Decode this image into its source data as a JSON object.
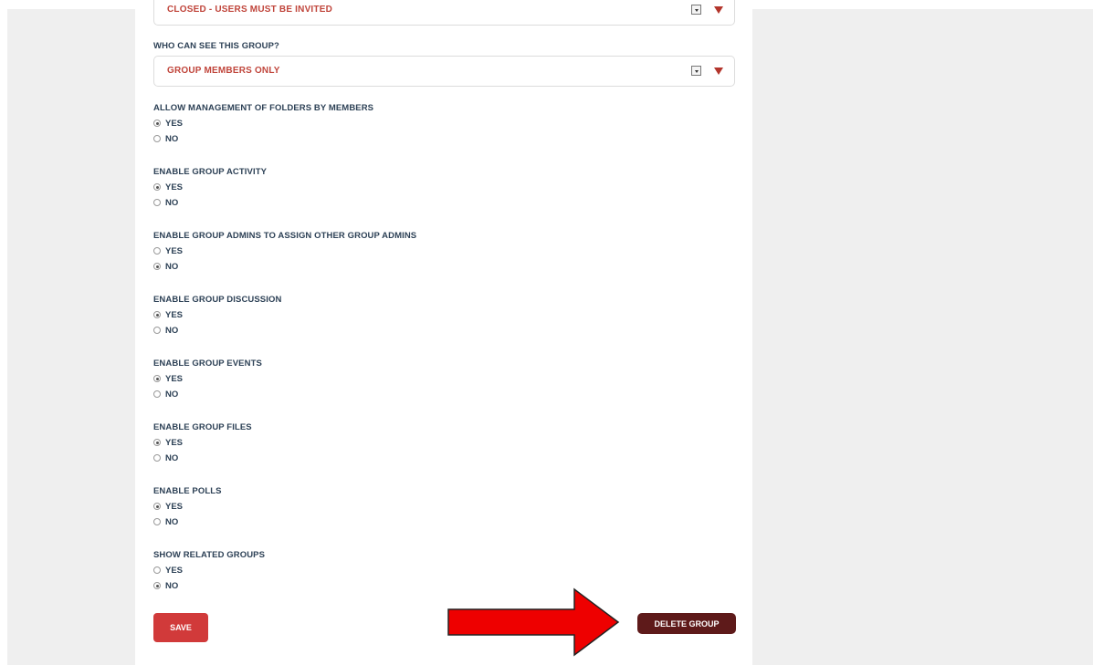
{
  "selects": {
    "membership": {
      "value": "CLOSED - USERS MUST BE INVITED"
    },
    "visibility": {
      "label": "WHO CAN SEE THIS GROUP?",
      "value": "GROUP MEMBERS ONLY"
    }
  },
  "settings": [
    {
      "label": "ALLOW MANAGEMENT OF FOLDERS BY MEMBERS",
      "yes": "YES",
      "no": "NO",
      "selected": "yes"
    },
    {
      "label": "ENABLE GROUP ACTIVITY",
      "yes": "YES",
      "no": "NO",
      "selected": "yes"
    },
    {
      "label": "ENABLE GROUP ADMINS TO ASSIGN OTHER GROUP ADMINS",
      "yes": "YES",
      "no": "NO",
      "selected": "no"
    },
    {
      "label": "ENABLE GROUP DISCUSSION",
      "yes": "YES",
      "no": "NO",
      "selected": "yes"
    },
    {
      "label": "ENABLE GROUP EVENTS",
      "yes": "YES",
      "no": "NO",
      "selected": "yes"
    },
    {
      "label": "ENABLE GROUP FILES",
      "yes": "YES",
      "no": "NO",
      "selected": "yes"
    },
    {
      "label": "ENABLE POLLS",
      "yes": "YES",
      "no": "NO",
      "selected": "yes"
    },
    {
      "label": "SHOW RELATED GROUPS",
      "yes": "YES",
      "no": "NO",
      "selected": "no"
    }
  ],
  "buttons": {
    "save": "SAVE",
    "delete": "DELETE GROUP"
  },
  "colors": {
    "accent": "#c0453b",
    "save": "#d13a3a",
    "delete": "#5e1a1a",
    "arrow": "#ee0000"
  },
  "icons": {
    "dropdown": "chevron-down-icon",
    "pointer": "right-arrow-icon"
  }
}
